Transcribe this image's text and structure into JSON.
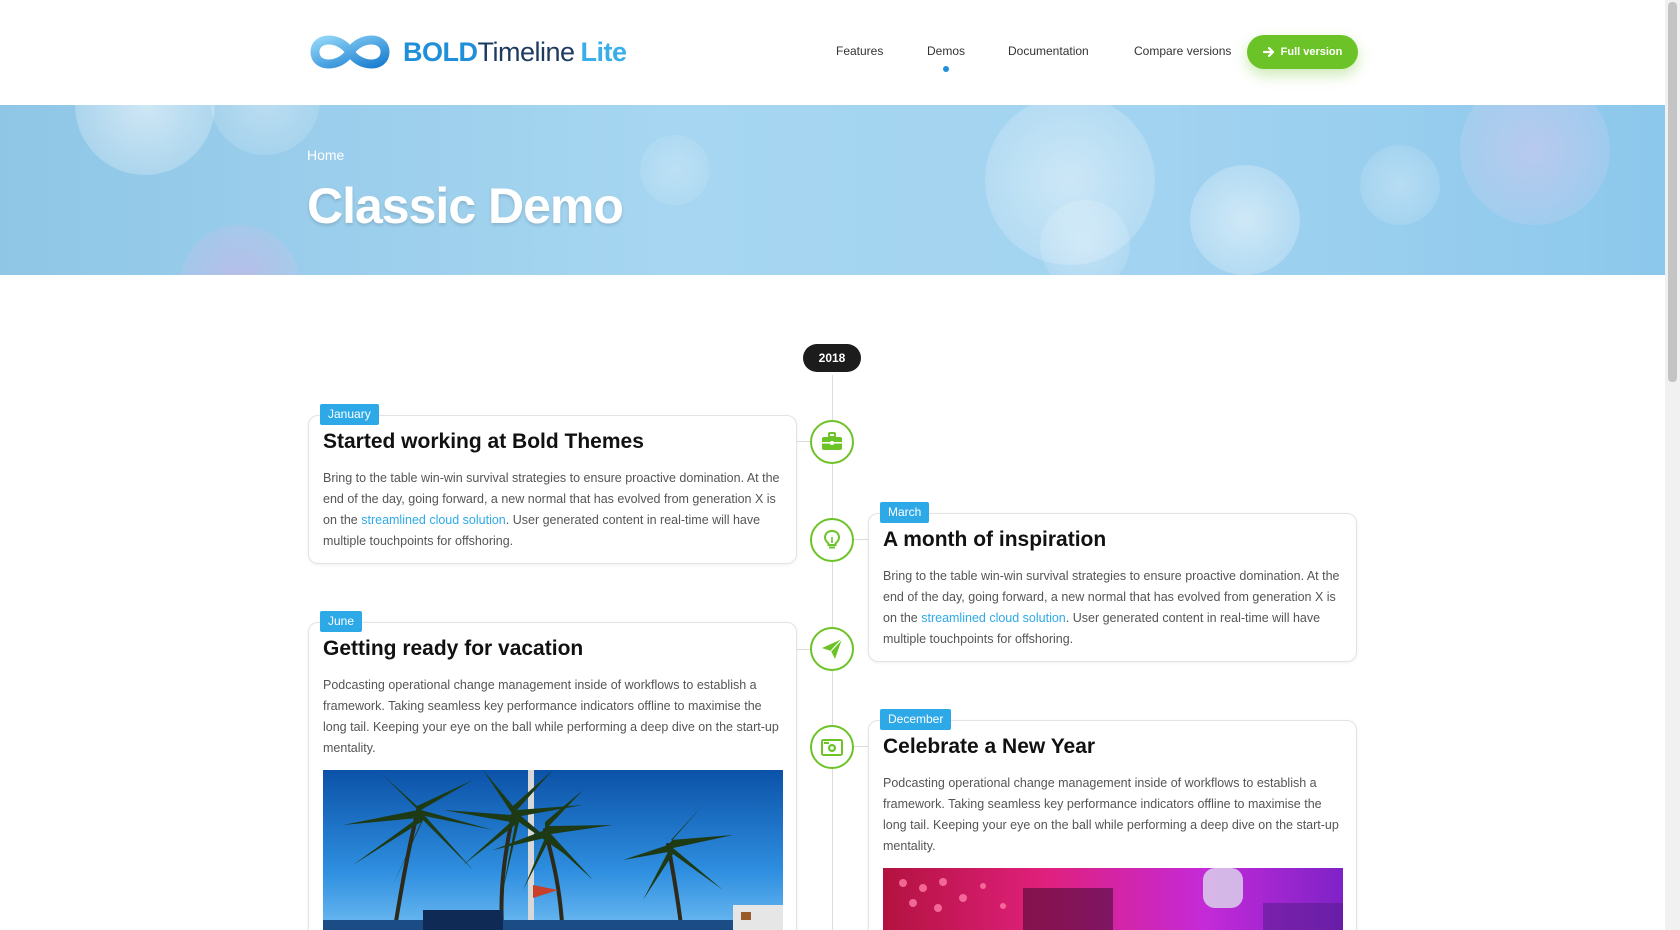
{
  "header": {
    "logo": {
      "bold": "BOLD",
      "timeline": "Timeline",
      "lite": "Lite"
    },
    "nav": [
      {
        "label": "Features"
      },
      {
        "label": "Demos"
      },
      {
        "label": "Documentation"
      },
      {
        "label": "Compare versions"
      }
    ],
    "cta_label": "Full version",
    "active_nav": "Demos"
  },
  "hero": {
    "breadcrumb": "Home",
    "title": "Classic Demo"
  },
  "timeline": {
    "year": "2018",
    "items": [
      {
        "month": "January",
        "title": "Started working at Bold Themes",
        "text_before": "Bring to the table win-win survival strategies to ensure proactive domination. At the end of the day, going forward, a new normal that has evolved from generation X is on the ",
        "link": "streamlined cloud solution",
        "text_after": ". User generated content in real-time will have multiple touchpoints for offshoring.",
        "icon": "briefcase-icon"
      },
      {
        "month": "March",
        "title": "A month of inspiration",
        "text_before": "Bring to the table win-win survival strategies to ensure proactive domination. At the end of the day, going forward, a new normal that has evolved from generation X is on the ",
        "link": "streamlined cloud solution",
        "text_after": ". User generated content in real-time will have multiple touchpoints for offshoring.",
        "icon": "lightbulb-icon"
      },
      {
        "month": "June",
        "title": "Getting ready for vacation",
        "text": "Podcasting operational change management inside of workflows to establish a framework. Taking seamless key performance indicators offline to maximise the long tail. Keeping your eye on the ball while performing a deep dive on the start-up mentality.",
        "icon": "paper-plane-icon",
        "image": "palm-trees-beach-photo"
      },
      {
        "month": "December",
        "title": "Celebrate a New Year",
        "text": "Podcasting operational change management inside of workflows to establish a framework. Taking seamless key performance indicators offline to maximise the long tail. Keeping your eye on the ball while performing a deep dive on the start-up mentality.",
        "icon": "camera-icon",
        "image": "dj-mixer-photo"
      }
    ]
  },
  "colors": {
    "accent_green": "#6cc327",
    "accent_blue": "#2ea9e8",
    "logo_blue": "#1e8fd8",
    "year_pill": "#1c1c1c"
  }
}
